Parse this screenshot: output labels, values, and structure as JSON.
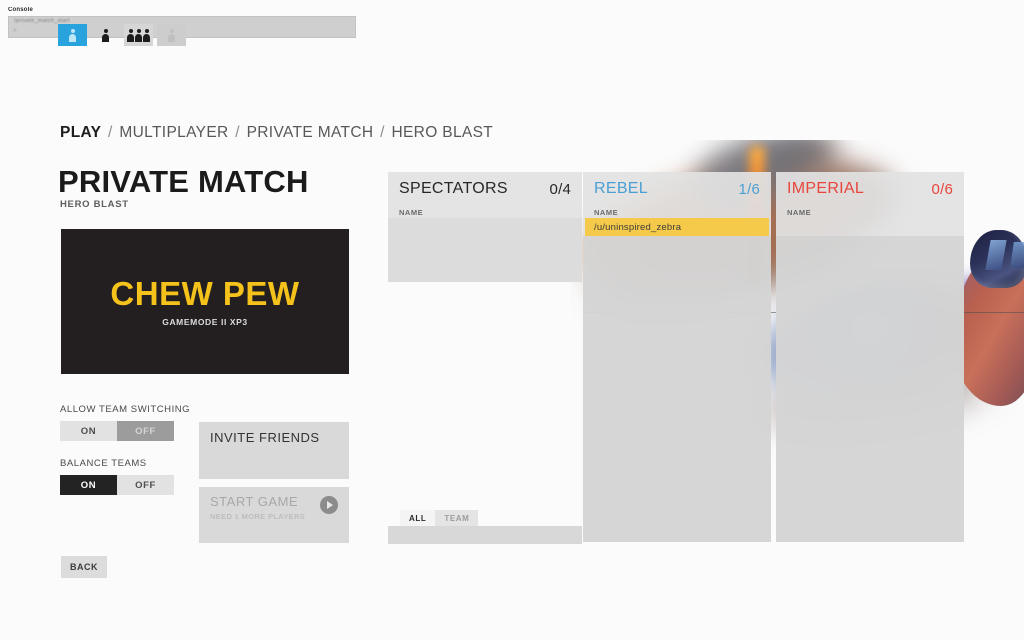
{
  "console": {
    "label": "Console",
    "input_value": "/private_match_start",
    "caret": ">",
    "icons": [
      {
        "name": "player-single-selected-icon",
        "state": "selected"
      },
      {
        "name": "player-single-icon",
        "state": "normal"
      },
      {
        "name": "player-group-icon",
        "state": "normal"
      },
      {
        "name": "player-disabled-icon",
        "state": "dim"
      }
    ]
  },
  "breadcrumb": {
    "root": "PLAY",
    "separator": "/",
    "items": [
      "MULTIPLAYER",
      "PRIVATE MATCH",
      "HERO BLAST"
    ]
  },
  "header": {
    "title": "PRIVATE MATCH",
    "subtitle": "HERO BLAST"
  },
  "mode_card": {
    "title": "CHEW PEW",
    "subtitle": "GAMEMODE II XP3",
    "bg_color": "#231f20",
    "title_color": "#f5c21b"
  },
  "options": [
    {
      "label": "ALLOW TEAM SWITCHING",
      "on_label": "ON",
      "off_label": "OFF",
      "selected": "OFF"
    },
    {
      "label": "BALANCE TEAMS",
      "on_label": "ON",
      "off_label": "OFF",
      "selected": "ON"
    }
  ],
  "actions": {
    "invite_label": "INVITE FRIENDS",
    "start_label": "START GAME",
    "start_sub": "NEED 1 MORE PLAYERS",
    "start_enabled": false,
    "play_icon": "play-circle-icon",
    "back_label": "BACK"
  },
  "rosters": {
    "column_header": "NAME",
    "spectators": {
      "title": "SPECTATORS",
      "count": "0/4",
      "title_color": "#272727",
      "players": []
    },
    "rebel": {
      "title": "REBEL",
      "count": "1/6",
      "title_color": "#4a9fd4",
      "players": [
        {
          "name": "/u/uninspired_zebra",
          "highlight_color": "#f5c94a"
        }
      ]
    },
    "imperial": {
      "title": "IMPERIAL",
      "count": "0/6",
      "title_color": "#e8453c",
      "players": []
    }
  },
  "chat": {
    "tabs": [
      {
        "label": "ALL",
        "active": true
      },
      {
        "label": "TEAM",
        "active": false
      }
    ],
    "input_value": ""
  }
}
